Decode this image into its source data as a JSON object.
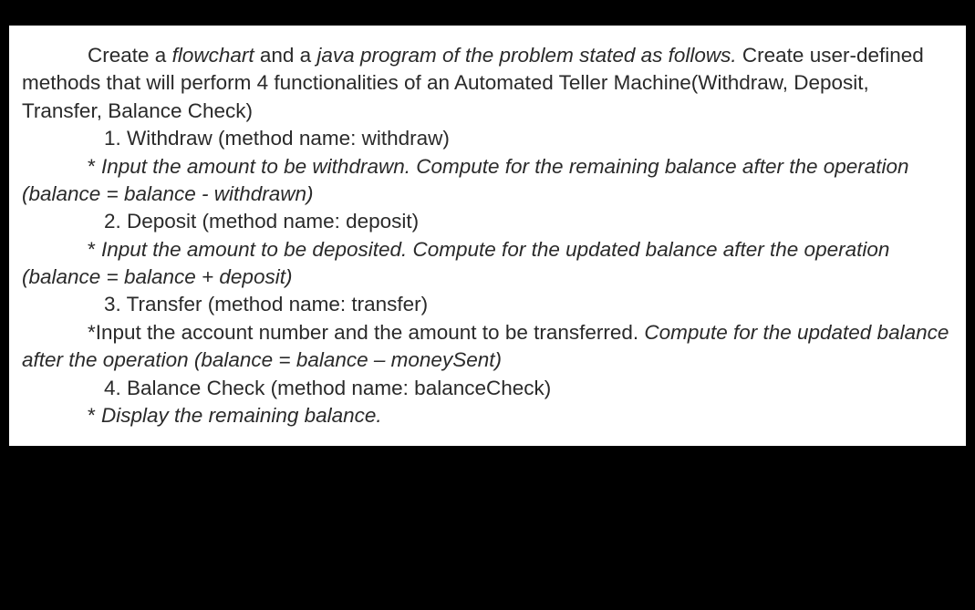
{
  "doc": {
    "intro_part1": "Create a ",
    "intro_italic1": "flowchart ",
    "intro_part2": "and a ",
    "intro_italic2": "java program of the problem stated as follows. ",
    "intro_part3": "Create user-defined methods that will perform 4 functionalities of an Automated Teller Machine(Withdraw, Deposit, Transfer, Balance Check)",
    "item1_title": "1. Withdraw (method name: withdraw)",
    "item1_desc_prefix": "* ",
    "item1_desc": "Input the amount to be withdrawn. Compute for the remaining balance after the operation (balance = balance - withdrawn)",
    "item2_title": "2. Deposit (method name: deposit)",
    "item2_desc_prefix": "* ",
    "item2_desc": "Input the amount to be deposited. Compute for the updated balance after the operation (balance = balance + deposit)",
    "item3_title": "3. Transfer (method name: transfer)",
    "item3_desc_prefix": "*",
    "item3_desc_part1": "Input the account number and the amount to be transferred. ",
    "item3_desc_part2": "Compute for the updated balance after the operation (balance = balance – moneySent)",
    "item4_title": "4. Balance Check (method name: balanceCheck)",
    "item4_desc_prefix": "* ",
    "item4_desc": "Display the remaining balance."
  }
}
